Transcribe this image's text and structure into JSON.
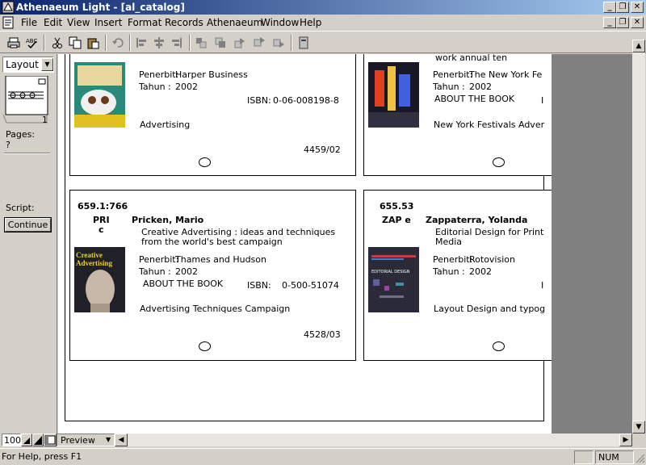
{
  "window": {
    "title": "Athenaeum Light - [al_catalog]"
  },
  "menu": [
    "File",
    "Edit",
    "View",
    "Insert",
    "Format",
    "Records",
    "Athenaeum",
    "Window",
    "Help"
  ],
  "left": {
    "layout_select": "Layout ...",
    "page_number": "1",
    "pages_label": "Pages:",
    "pages_value": "?",
    "script_label": "Script:",
    "continue_button": "Continue"
  },
  "cards": [
    {
      "top_text": "",
      "penerbit_label": "Penerbit:",
      "publisher": "Harper Business",
      "tahun_label": "Tahun :",
      "year": "2002",
      "isbn_label": "ISBN:",
      "isbn": "0-06-008198-8",
      "subject": "Advertising",
      "record_number": "4459/02"
    },
    {
      "top_text": "work annual ten",
      "penerbit_label": "Penerbit:",
      "publisher": "The New York Fe",
      "tahun_label": "Tahun :",
      "year": "2002",
      "about": "ABOUT THE BOOK",
      "isbn_label": "I",
      "subject": "New York Festivals Adver"
    },
    {
      "call_number": "659.1:766",
      "call_code": "PRI",
      "call_suffix": "c",
      "author": "Pricken, Mario",
      "title_line1": "Creative Advertising : ideas and techniques",
      "title_line2": "from the world's best campaign",
      "penerbit_label": "Penerbit:",
      "publisher": "Thames and Hudson",
      "tahun_label": "Tahun :",
      "year": "2002",
      "about": "ABOUT THE BOOK",
      "isbn_label": "ISBN:",
      "isbn": "0-500-51074",
      "subject": "Advertising Techniques Campaign",
      "record_number": "4528/03",
      "cover_text1": "Creative",
      "cover_text2": "Advertising"
    },
    {
      "call_number": "655.53",
      "call_code": "ZAP e",
      "author": "Zappaterra, Yolanda",
      "title_line1": "Editorial Design for Print",
      "title_line2": "Media",
      "penerbit_label": "Penerbit:",
      "publisher": "Rotovision",
      "tahun_label": "Tahun :",
      "year": "2002",
      "isbn_label": "I",
      "subject": "Layout Design and typog",
      "cover_text1": "EDITORIAL DESIGN"
    }
  ],
  "bottom": {
    "zoom": "100",
    "mode": "Preview"
  },
  "status": {
    "help_text": "For Help, press F1",
    "num": "NUM"
  }
}
